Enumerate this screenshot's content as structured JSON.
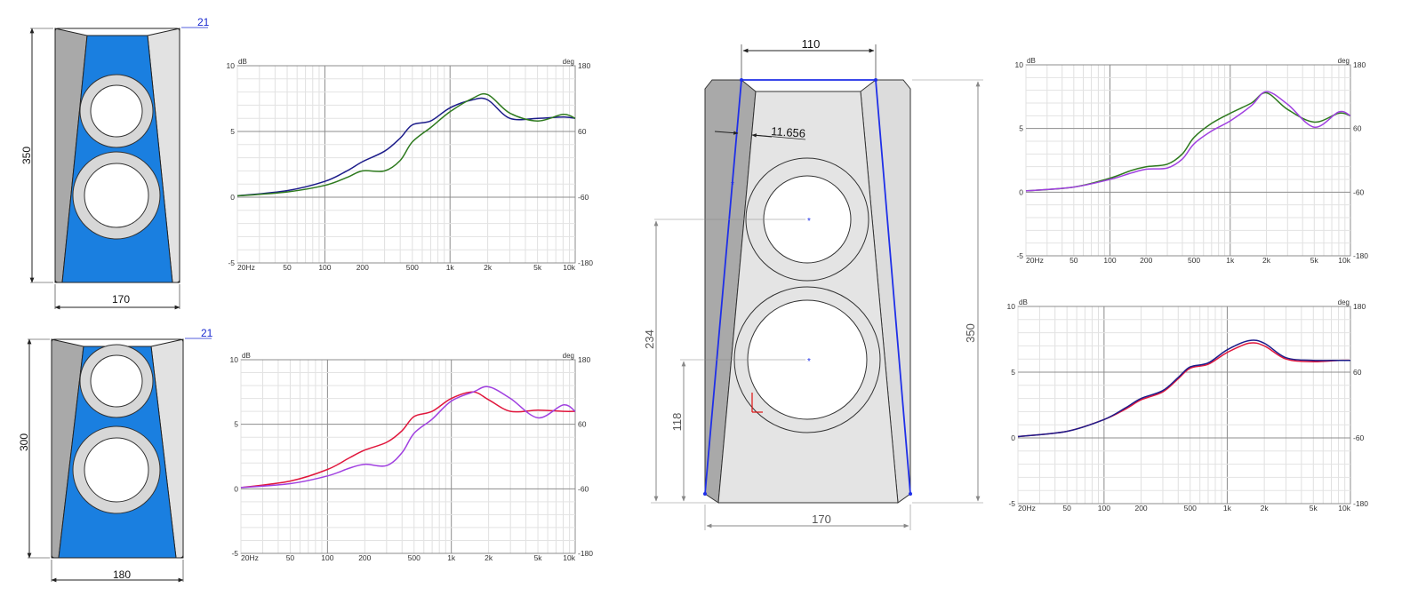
{
  "colors": {
    "blue_baffle": "#1a7fe0",
    "panel_dark": "#a9a9a9",
    "panel_light": "#e2e2e2",
    "driver_ring": "#d7d7d7",
    "sketch_blue": "#1f2fe8",
    "series_navy": "#1c1c8a",
    "series_green": "#2e7a1e",
    "series_red": "#e0163c",
    "series_purple": "#a040e0",
    "dim_text": "#555555"
  },
  "diagrams": [
    {
      "height_dim": "350",
      "width_dim": "170",
      "bevel_dim": "21"
    },
    {
      "height_dim": "300",
      "width_dim": "180",
      "bevel_dim": "21"
    }
  ],
  "sketch": {
    "top_dim": "110",
    "angle_dim": "11.656",
    "height_dim": "350",
    "width_dim": "170",
    "woofer_center_dim": "118",
    "tweeter_center_dim": "234"
  },
  "axis_labels": {
    "y_unit_left": "dB",
    "y_unit_right": "deg",
    "y_ticks": [
      "10",
      "5",
      "0",
      "-5"
    ],
    "phase_ticks": [
      "180",
      "60",
      "-60",
      "-180"
    ],
    "x_ticks": [
      "20Hz",
      "50",
      "100",
      "200",
      "500",
      "1k",
      "2k",
      "5k",
      "10k"
    ]
  },
  "chart_data": [
    {
      "type": "line",
      "x_scale": "log",
      "xlim": [
        20,
        10000
      ],
      "ylim": [
        -5,
        10
      ],
      "grid": true,
      "series": [
        {
          "x": [
            20,
            50,
            100,
            150,
            200,
            300,
            400,
            500,
            700,
            1000,
            1500,
            2000,
            3000,
            5000,
            8000,
            10000
          ],
          "y": [
            0.1,
            0.5,
            1.2,
            2.0,
            2.7,
            3.5,
            4.5,
            5.5,
            5.8,
            6.8,
            7.4,
            7.4,
            6.0,
            6.0,
            6.1,
            6.0
          ]
        },
        {
          "x": [
            20,
            50,
            100,
            150,
            200,
            300,
            400,
            500,
            700,
            1000,
            1500,
            2000,
            3000,
            5000,
            8000,
            10000
          ],
          "y": [
            0.1,
            0.4,
            0.9,
            1.5,
            2.0,
            2.0,
            2.8,
            4.2,
            5.3,
            6.5,
            7.5,
            7.8,
            6.4,
            5.8,
            6.3,
            6.0
          ]
        }
      ]
    },
    {
      "type": "line",
      "x_scale": "log",
      "xlim": [
        20,
        10000
      ],
      "ylim": [
        -5,
        10
      ],
      "grid": true,
      "series": [
        {
          "x": [
            20,
            50,
            100,
            150,
            200,
            300,
            400,
            500,
            700,
            1000,
            1500,
            2000,
            3000,
            5000,
            8000,
            10000
          ],
          "y": [
            0.1,
            0.6,
            1.5,
            2.4,
            3.0,
            3.6,
            4.5,
            5.6,
            6.0,
            7.0,
            7.5,
            6.9,
            6.0,
            6.1,
            6.0,
            6.0
          ]
        },
        {
          "x": [
            20,
            50,
            100,
            150,
            200,
            300,
            400,
            500,
            700,
            1000,
            1500,
            2000,
            3000,
            5000,
            8000,
            10000
          ],
          "y": [
            0.1,
            0.4,
            1.0,
            1.6,
            1.9,
            1.8,
            2.8,
            4.3,
            5.4,
            6.8,
            7.5,
            7.9,
            7.0,
            5.5,
            6.5,
            6.0
          ]
        }
      ]
    },
    {
      "type": "line",
      "x_scale": "log",
      "xlim": [
        20,
        10000
      ],
      "ylim": [
        -5,
        10
      ],
      "grid": true,
      "series": [
        {
          "x": [
            20,
            50,
            100,
            150,
            200,
            300,
            400,
            500,
            700,
            1000,
            1500,
            2000,
            3000,
            5000,
            8000,
            10000
          ],
          "y": [
            0.1,
            0.4,
            1.1,
            1.7,
            2.0,
            2.2,
            3.0,
            4.3,
            5.4,
            6.2,
            7.0,
            7.8,
            6.5,
            5.5,
            6.2,
            6.0
          ]
        },
        {
          "x": [
            20,
            50,
            100,
            150,
            200,
            300,
            400,
            500,
            700,
            1000,
            1500,
            2000,
            3000,
            5000,
            8000,
            10000
          ],
          "y": [
            0.1,
            0.4,
            1.0,
            1.5,
            1.8,
            1.9,
            2.6,
            3.8,
            4.8,
            5.6,
            6.8,
            7.9,
            6.9,
            5.1,
            6.3,
            6.0
          ]
        }
      ]
    },
    {
      "type": "line",
      "x_scale": "log",
      "xlim": [
        20,
        10000
      ],
      "ylim": [
        -5,
        10
      ],
      "grid": true,
      "series": [
        {
          "x": [
            20,
            50,
            100,
            150,
            200,
            300,
            400,
            500,
            700,
            1000,
            1500,
            2000,
            3000,
            5000,
            8000,
            10000
          ],
          "y": [
            0.1,
            0.5,
            1.4,
            2.2,
            2.9,
            3.5,
            4.5,
            5.3,
            5.6,
            6.5,
            7.2,
            7.0,
            6.0,
            5.8,
            5.9,
            5.9
          ]
        },
        {
          "x": [
            20,
            50,
            100,
            150,
            200,
            300,
            400,
            500,
            700,
            1000,
            1500,
            2000,
            3000,
            5000,
            8000,
            10000
          ],
          "y": [
            0.1,
            0.5,
            1.4,
            2.3,
            3.0,
            3.6,
            4.6,
            5.4,
            5.7,
            6.7,
            7.4,
            7.2,
            6.1,
            5.9,
            5.9,
            5.9
          ]
        }
      ]
    }
  ]
}
